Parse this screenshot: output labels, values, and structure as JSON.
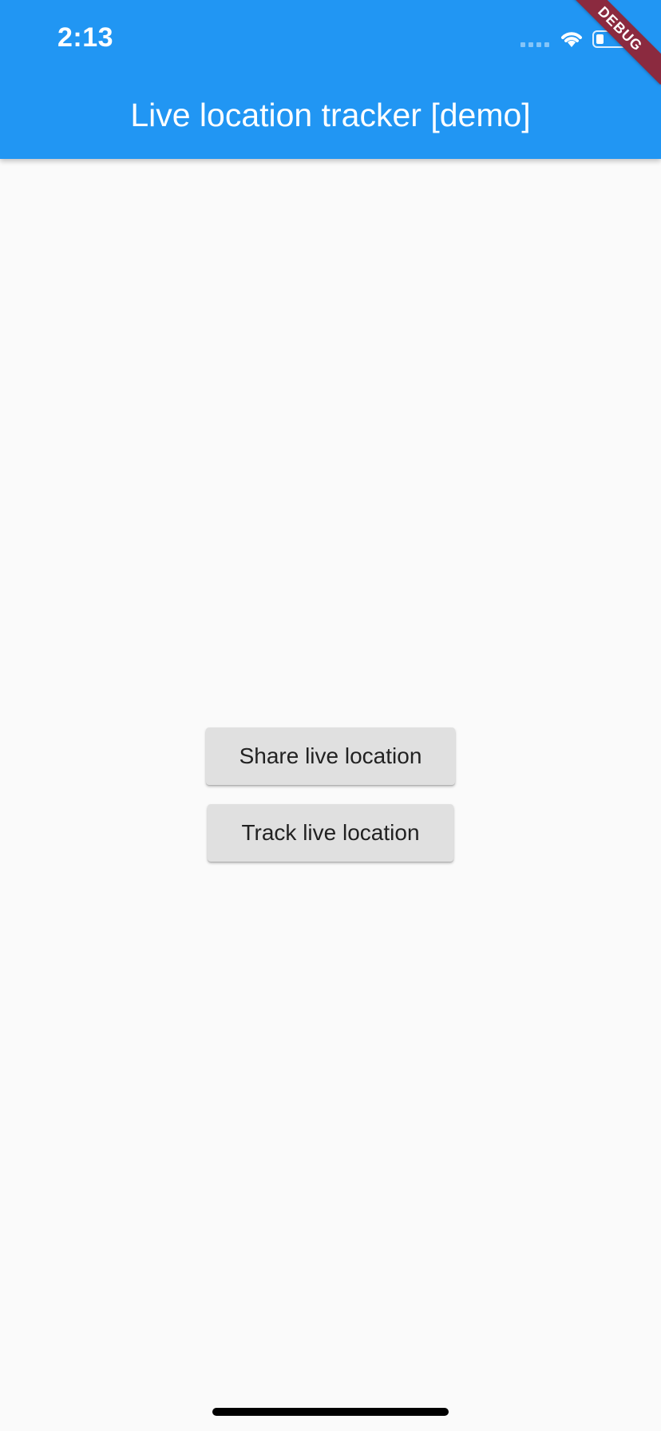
{
  "status_bar": {
    "time": "2:13",
    "icons": [
      "signal-icon",
      "wifi-icon",
      "battery-icon"
    ]
  },
  "app_bar": {
    "title": "Live location tracker [demo]",
    "color": "#2196f3"
  },
  "debug_banner": {
    "label": "DEBUG",
    "color": "#8b2a3f"
  },
  "actions": {
    "share_label": "Share live location",
    "track_label": "Track live location"
  },
  "colors": {
    "background": "#fafafa",
    "button": "#e0e0e0",
    "button_text": "#222222"
  }
}
